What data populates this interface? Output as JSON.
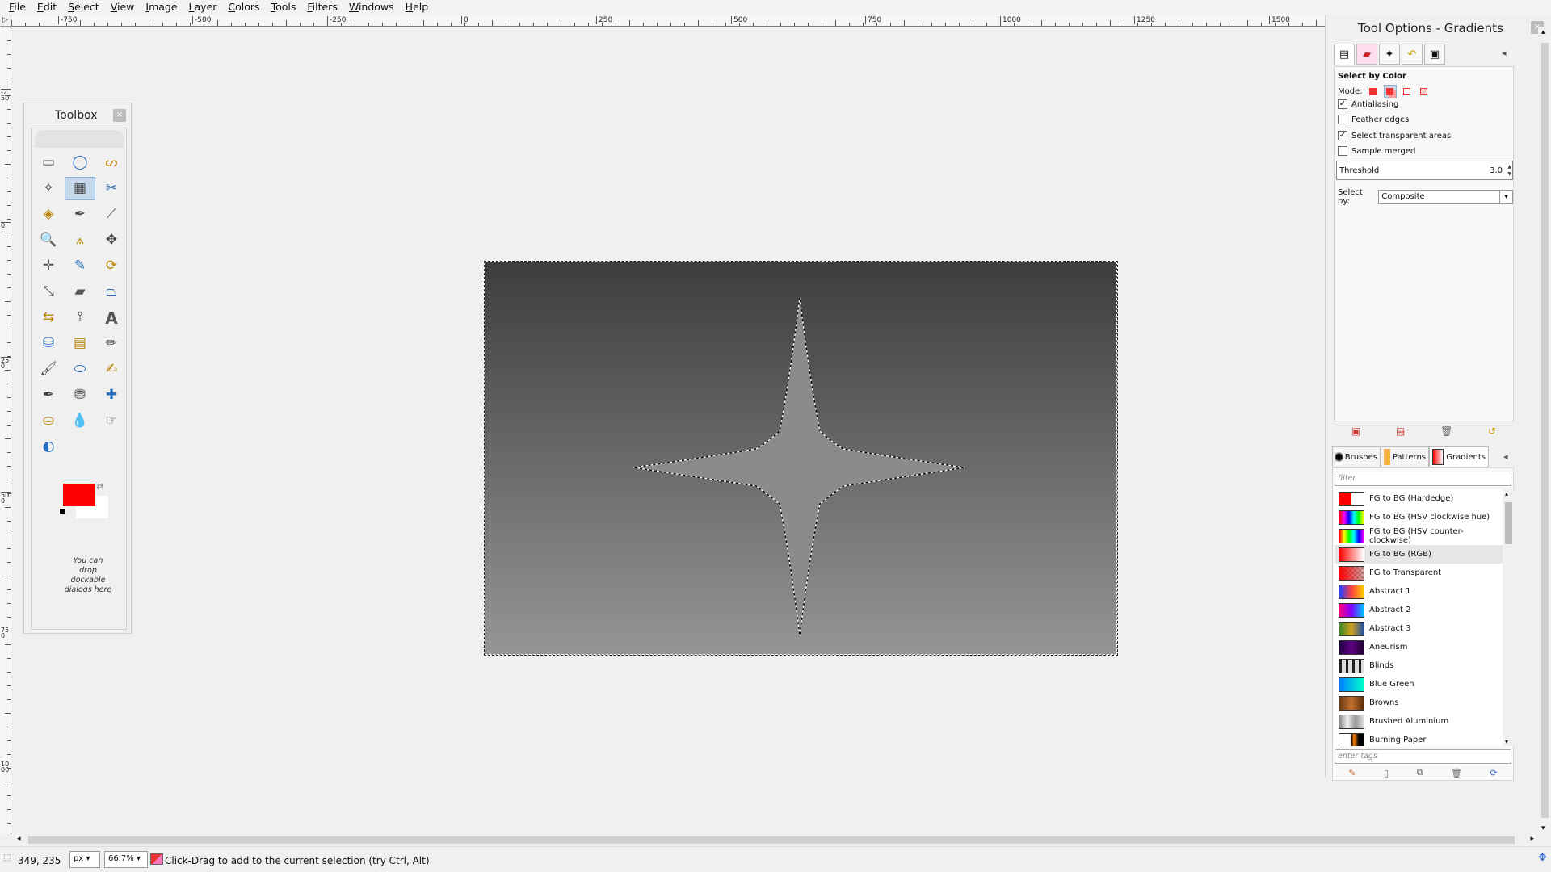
{
  "menubar": {
    "items": [
      "File",
      "Edit",
      "Select",
      "View",
      "Image",
      "Layer",
      "Colors",
      "Tools",
      "Filters",
      "Windows",
      "Help"
    ]
  },
  "rulers": {
    "top_labels": [
      "-750",
      "-500",
      "-250",
      "0",
      "250",
      "500",
      "750",
      "1000",
      "1250",
      "1500"
    ],
    "left_labels": [
      "-250",
      "0",
      "250",
      "500",
      "750",
      "1000"
    ]
  },
  "toolbox": {
    "title": "Toolbox",
    "close_glyph": "×",
    "drop_hint": "You can drop dockable dialogs here",
    "fg_color": "#ff0000",
    "bg_color": "#ffffff",
    "tools": [
      {
        "name": "rect-select-tool",
        "glyph": "▭"
      },
      {
        "name": "ellipse-select-tool",
        "glyph": "◯"
      },
      {
        "name": "free-select-tool",
        "glyph": "ᔕ"
      },
      {
        "name": "fuzzy-select-tool",
        "glyph": "✧"
      },
      {
        "name": "select-by-color-tool",
        "glyph": "▦"
      },
      {
        "name": "scissors-select-tool",
        "glyph": "✂"
      },
      {
        "name": "foreground-select-tool",
        "glyph": "◈"
      },
      {
        "name": "paths-tool",
        "glyph": "✒"
      },
      {
        "name": "color-picker-tool",
        "glyph": "⟋"
      },
      {
        "name": "zoom-tool",
        "glyph": "🔍"
      },
      {
        "name": "measure-tool",
        "glyph": "⟑"
      },
      {
        "name": "move-tool",
        "glyph": "✥"
      },
      {
        "name": "align-tool",
        "glyph": "✛"
      },
      {
        "name": "crop-tool",
        "glyph": "✎"
      },
      {
        "name": "rotate-tool",
        "glyph": "⟳"
      },
      {
        "name": "scale-tool",
        "glyph": "⤡"
      },
      {
        "name": "shear-tool",
        "glyph": "▰"
      },
      {
        "name": "perspective-tool",
        "glyph": "⏢"
      },
      {
        "name": "flip-tool",
        "glyph": "⇆"
      },
      {
        "name": "cage-transform-tool",
        "glyph": "⟟"
      },
      {
        "name": "text-tool",
        "glyph": "A"
      },
      {
        "name": "bucket-fill-tool",
        "glyph": "⛁"
      },
      {
        "name": "blend-tool",
        "glyph": "▤"
      },
      {
        "name": "pencil-tool",
        "glyph": "✏"
      },
      {
        "name": "paintbrush-tool",
        "glyph": "🖌"
      },
      {
        "name": "eraser-tool",
        "glyph": "⬭"
      },
      {
        "name": "airbrush-tool",
        "glyph": "✍"
      },
      {
        "name": "ink-tool",
        "glyph": "✒"
      },
      {
        "name": "clone-tool",
        "glyph": "⛃"
      },
      {
        "name": "heal-tool",
        "glyph": "✚"
      },
      {
        "name": "perspective-clone-tool",
        "glyph": "⛀"
      },
      {
        "name": "blur-sharpen-tool",
        "glyph": "💧"
      },
      {
        "name": "smudge-tool",
        "glyph": "☞"
      },
      {
        "name": "dodge-burn-tool",
        "glyph": "◐"
      }
    ]
  },
  "tool_options": {
    "dock_title": "Tool Options - Gradients",
    "panel_title": "Select by Color",
    "mode_label": "Mode:",
    "antialiasing": "Antialiasing",
    "feather_edges": "Feather edges",
    "select_transparent": "Select transparent areas",
    "sample_merged": "Sample merged",
    "threshold_label": "Threshold",
    "threshold_value": "3.0",
    "select_by_label": "Select by:",
    "select_by_value": "Composite"
  },
  "resources": {
    "tabs": [
      "Brushes",
      "Patterns",
      "Gradients"
    ],
    "filter_placeholder": "filter",
    "tags_placeholder": "enter tags",
    "gradients": [
      {
        "name": "FG to BG (Hardedge)",
        "css": "linear-gradient(to right,#ff0000 50%,#ffffff 50%)"
      },
      {
        "name": "FG to BG (HSV clockwise hue)",
        "css": "linear-gradient(to right,#ff0000,#ff00ff,#0000ff,#00ffff,#00ff00,#ffff00)"
      },
      {
        "name": "FG to BG (HSV counter-clockwise)",
        "css": "linear-gradient(to right,#ff0000,#ffff00,#00ff00,#00ffff,#0000ff,#ff00ff)"
      },
      {
        "name": "FG to BG (RGB)",
        "css": "linear-gradient(to right,#ff0000,#ffffff)"
      },
      {
        "name": "FG to Transparent",
        "css": "linear-gradient(to right,#ff0000,#ff000030),repeating-conic-gradient(#999 0 25%,#ccc 0 50%) 0 0/6px 6px"
      },
      {
        "name": "Abstract 1",
        "css": "linear-gradient(to right,#2040ff,#ff4040,#ffcc00)"
      },
      {
        "name": "Abstract 2",
        "css": "linear-gradient(to right,#ff0080,#8000ff,#00c0ff)"
      },
      {
        "name": "Abstract 3",
        "css": "linear-gradient(to right,#3a8a2a,#d0a020,#2050a0)"
      },
      {
        "name": "Aneurism",
        "css": "linear-gradient(to right,#200040,#600080,#200030)"
      },
      {
        "name": "Blinds",
        "css": "repeating-linear-gradient(to right,#222 0 3px,#ddd 3px 8px)"
      },
      {
        "name": "Blue Green",
        "css": "linear-gradient(to right,#0080ff,#00ffcc)"
      },
      {
        "name": "Browns",
        "css": "linear-gradient(to right,#6b3a10,#c07030,#5a2e08)"
      },
      {
        "name": "Brushed Aluminium",
        "css": "linear-gradient(to right,#888,#eee,#999,#ddd)"
      },
      {
        "name": "Burning Paper",
        "css": "linear-gradient(to right,#fff 45%,#000 50%,#ff8000 60%,#000 80%)"
      }
    ]
  },
  "statusbar": {
    "coords": "349, 235",
    "unit": "px",
    "zoom": "66.7%",
    "message": "Click-Drag to add to the current selection (try Ctrl, Alt)"
  }
}
